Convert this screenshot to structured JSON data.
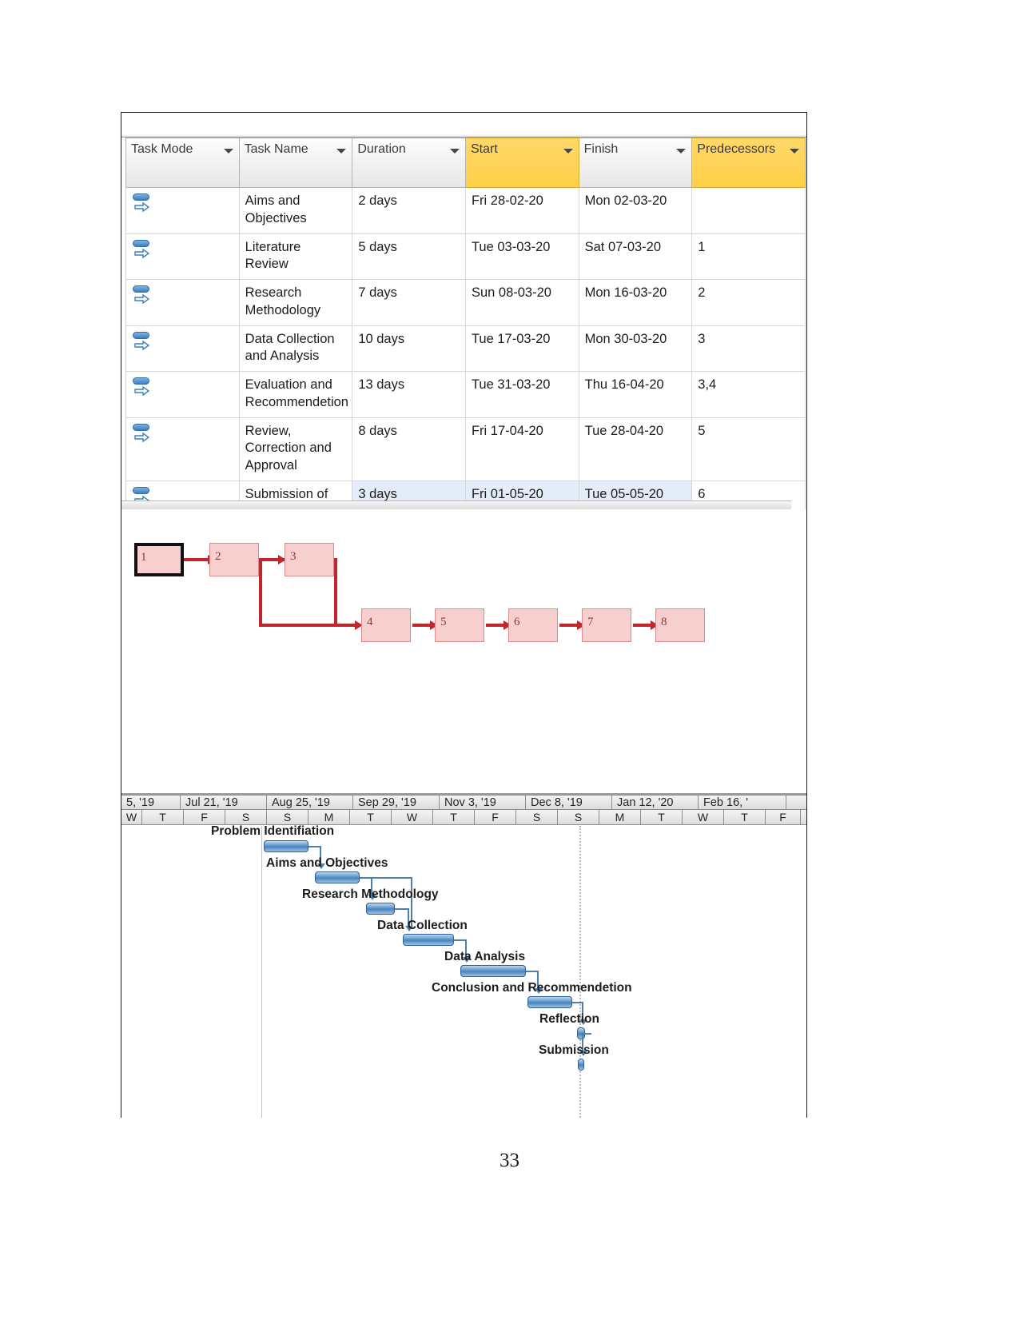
{
  "document": {
    "page_number": "33"
  },
  "task_table": {
    "columns": [
      {
        "id": "task_mode",
        "label": "Task Mode",
        "header_color": "#e6e6e6",
        "has_filter": true
      },
      {
        "id": "task_name",
        "label": "Task Name",
        "header_color": "#e6e6e6",
        "has_filter": true
      },
      {
        "id": "duration",
        "label": "Duration",
        "header_color": "#e6e6e6",
        "has_filter": true
      },
      {
        "id": "start",
        "label": "Start",
        "header_color": "#ffcf45",
        "has_filter": true
      },
      {
        "id": "finish",
        "label": "Finish",
        "header_color": "#e6e6e6",
        "has_filter": true
      },
      {
        "id": "predecessors",
        "label": "Predecessors",
        "header_color": "#ffcf45",
        "has_filter": true
      }
    ],
    "rows": [
      {
        "task_mode_icon": "auto-scheduled-icon",
        "task_name": "Aims and Objectives",
        "duration": "2 days",
        "start": "Fri 28-02-20",
        "finish": "Mon 02-03-20",
        "predecessors": "",
        "selected": false
      },
      {
        "task_mode_icon": "auto-scheduled-icon",
        "task_name": "Literature Review",
        "duration": "5 days",
        "start": "Tue 03-03-20",
        "finish": "Sat 07-03-20",
        "predecessors": "1",
        "selected": false
      },
      {
        "task_mode_icon": "auto-scheduled-icon",
        "task_name": "Research Methodology",
        "duration": "7 days",
        "start": "Sun 08-03-20",
        "finish": "Mon 16-03-20",
        "predecessors": "2",
        "selected": false
      },
      {
        "task_mode_icon": "auto-scheduled-icon",
        "task_name": "Data Collection and Analysis",
        "duration": "10 days",
        "start": "Tue 17-03-20",
        "finish": "Mon 30-03-20",
        "predecessors": "3",
        "selected": false
      },
      {
        "task_mode_icon": "auto-scheduled-icon",
        "task_name": "Evaluation and Recommendetion",
        "duration": "13 days",
        "start": "Tue 31-03-20",
        "finish": "Thu 16-04-20",
        "predecessors": "3,4",
        "selected": false
      },
      {
        "task_mode_icon": "auto-scheduled-icon",
        "task_name": "Review, Correction and Approval",
        "duration": "8 days",
        "start": "Fri 17-04-20",
        "finish": "Tue 28-04-20",
        "predecessors": "5",
        "selected": false
      },
      {
        "task_mode_icon": "auto-scheduled-icon",
        "task_name": "Submission of final report",
        "duration": "3 days",
        "start": "Fri 01-05-20",
        "finish": "Tue 05-05-20",
        "predecessors": "6",
        "selected": true
      }
    ]
  },
  "network_diagram": {
    "node_fill": "#f8cfcf",
    "node_border": "#d98b8b",
    "link_color": "#c0272d",
    "nodes": [
      {
        "id": "1",
        "label": "1",
        "selected": true
      },
      {
        "id": "2",
        "label": "2",
        "selected": false
      },
      {
        "id": "3",
        "label": "3",
        "selected": false
      },
      {
        "id": "4",
        "label": "4",
        "selected": false
      },
      {
        "id": "5",
        "label": "5",
        "selected": false
      },
      {
        "id": "6",
        "label": "6",
        "selected": false
      },
      {
        "id": "7",
        "label": "7",
        "selected": false
      },
      {
        "id": "8",
        "label": "8",
        "selected": false
      }
    ],
    "links": [
      {
        "from": "1",
        "to": "2"
      },
      {
        "from": "2",
        "to": "3"
      },
      {
        "from": "2",
        "to": "4"
      },
      {
        "from": "3",
        "to": "4"
      },
      {
        "from": "4",
        "to": "5"
      },
      {
        "from": "5",
        "to": "6"
      },
      {
        "from": "6",
        "to": "7"
      },
      {
        "from": "7",
        "to": "8"
      }
    ]
  },
  "gantt_chart": {
    "timeline_major": [
      {
        "label": "5, '19"
      },
      {
        "label": "Jul 21, '19"
      },
      {
        "label": "Aug 25, '19"
      },
      {
        "label": "Sep 29, '19"
      },
      {
        "label": "Nov 3, '19"
      },
      {
        "label": "Dec 8, '19"
      },
      {
        "label": "Jan 12, '20"
      },
      {
        "label": "Feb 16, '"
      }
    ],
    "timeline_days": [
      "W",
      "T",
      "F",
      "S",
      "S",
      "M",
      "T",
      "W",
      "T",
      "F",
      "S",
      "S",
      "M",
      "T",
      "W",
      "T",
      "F"
    ],
    "bar_color": "#5d94c9",
    "bar_border": "#2e6097",
    "tasks": [
      {
        "label": "Problem Identifiation"
      },
      {
        "label": "Aims and Objectives"
      },
      {
        "label": "Research Methodology"
      },
      {
        "label": "Data Collection"
      },
      {
        "label": "Data Analysis"
      },
      {
        "label": "Conclusion and Recommendetion"
      },
      {
        "label": "Reflection"
      },
      {
        "label": "Submission"
      }
    ]
  }
}
